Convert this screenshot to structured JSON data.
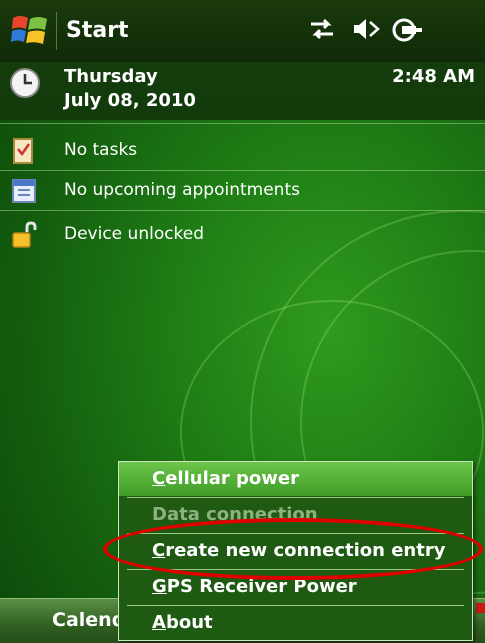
{
  "taskbar": {
    "title": "Start",
    "status_icons": [
      "connectivity-icon",
      "speaker-muted-icon",
      "battery-charging-icon"
    ]
  },
  "today": {
    "day": "Thursday",
    "date": "July 08, 2010",
    "time": "2:48 AM",
    "rows": [
      {
        "icon": "tasks-icon",
        "label": "No tasks"
      },
      {
        "icon": "calendar-icon",
        "label": "No upcoming appointments"
      },
      {
        "icon": "unlocked-padlock-icon",
        "label": "Device unlocked"
      }
    ]
  },
  "softkeys": {
    "left_label": "Calend"
  },
  "context_menu": {
    "items": [
      {
        "mnemonic": "C",
        "rest": "ellular power",
        "state": "selected"
      },
      {
        "mnemonic": "",
        "rest": "Data connection",
        "state": "disabled"
      },
      {
        "mnemonic": "C",
        "rest": "reate new connection entry",
        "state": "normal"
      },
      {
        "mnemonic": "G",
        "rest": "PS Receiver Power",
        "state": "normal"
      },
      {
        "mnemonic": "A",
        "rest": "bout",
        "state": "normal"
      }
    ]
  },
  "colors": {
    "highlight_annotation": "#e00000",
    "menu_selected": "#4fae32",
    "background_green": "#1f7f15"
  }
}
